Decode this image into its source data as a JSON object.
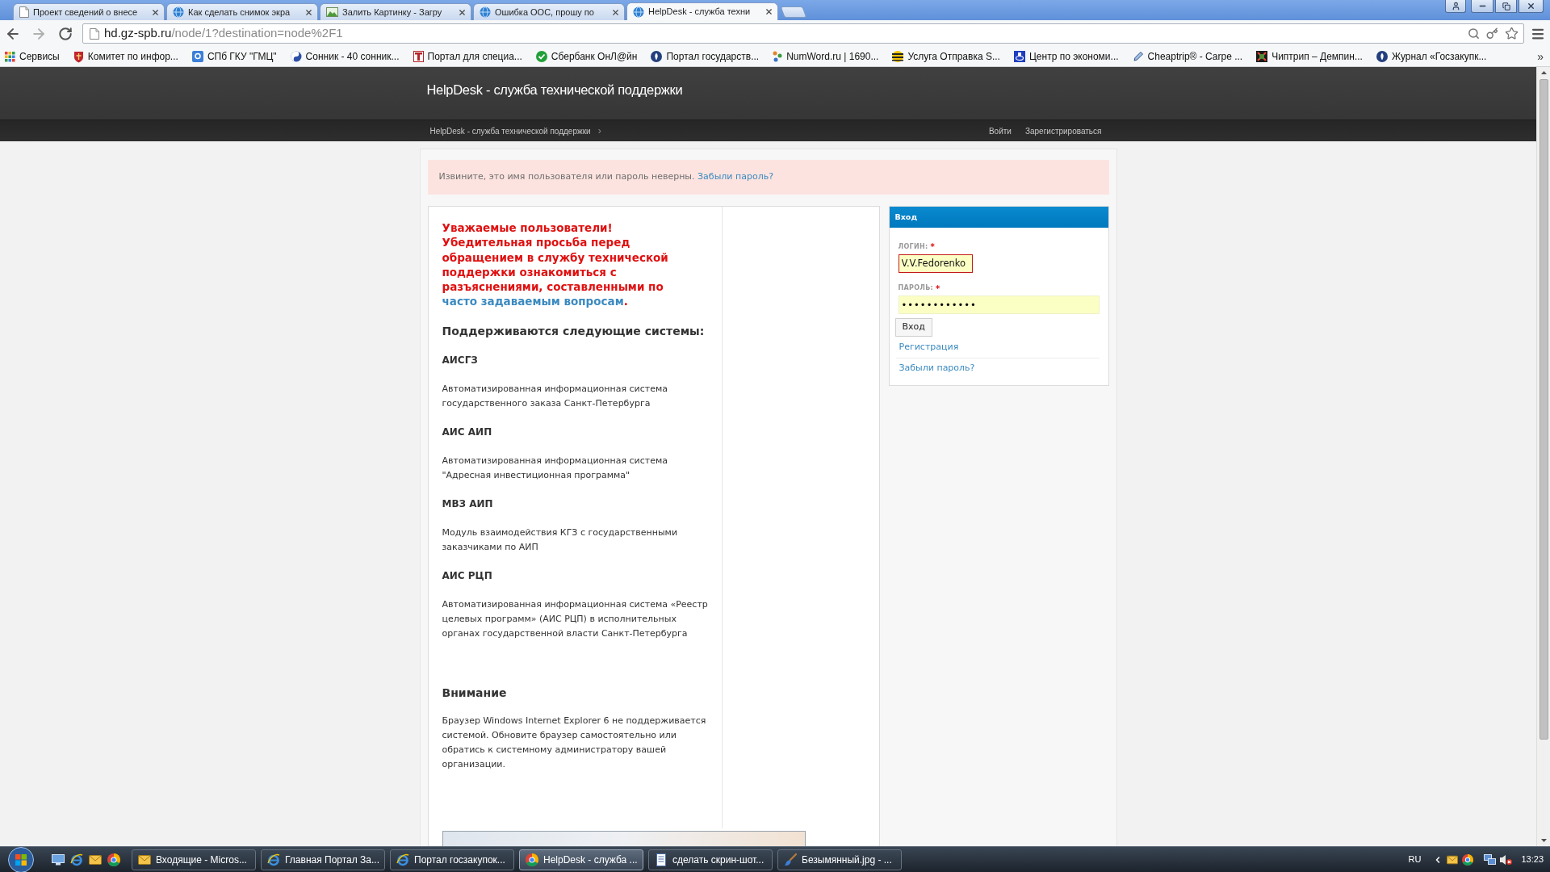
{
  "browser": {
    "tabs": [
      {
        "title": "Проект сведений о внесе",
        "selected": false
      },
      {
        "title": "Как сделать снимок экра",
        "selected": false
      },
      {
        "title": "Залить Картинку - Загру",
        "selected": false
      },
      {
        "title": "Ошибка ООС, прошу по",
        "selected": false
      },
      {
        "title": "HelpDesk - служба техни",
        "selected": true
      }
    ],
    "url": {
      "host": "hd.gz-spb.ru",
      "path": "/node/1?destination=node%2F1"
    },
    "bookmarks": [
      "Сервисы",
      "Комитет по инфор...",
      "СПб ГКУ \"ГМЦ\"",
      "Сонник - 40 сонник...",
      "Портал для специа...",
      "Сбербанк ОнЛ@йн",
      "Портал государств...",
      "NumWord.ru | 1690...",
      "Услуга Отправка S...",
      "Центр по экономи...",
      "Cheaptrip® - Carpe ...",
      "Чиптрип – Демпин...",
      "Журнал «Госзакупк..."
    ],
    "bookmarks_overflow": "»"
  },
  "site": {
    "title": "HelpDesk - служба технической поддержки",
    "breadcrumb": "HelpDesk - служба технической поддержки",
    "breadcrumb_separator": "›",
    "nav": [
      "Войти",
      "Зарегистрироваться"
    ]
  },
  "alert": {
    "text": "Извините, это имя пользователя или пароль неверны.",
    "link": "Забыли пароль?"
  },
  "notice": {
    "text": "Уважаемые пользователи! Убедительная просьба перед обращением в службу технической поддержки ознакомиться с разъяснениями, составленными по",
    "link": "часто задаваемым вопросам",
    "end": "."
  },
  "systems_heading": "Поддерживаются следующие системы:",
  "systems": [
    {
      "name": "АИСГЗ",
      "description": "Автоматизированная информационная система государственного заказа Санкт-Петербурга"
    },
    {
      "name": "АИС АИП",
      "description": "Автоматизированная информационная система \"Адресная инвестиционная программа\""
    },
    {
      "name": "МВЗ АИП",
      "description": "Модуль взаимодействия КГЗ с государственными заказчиками по АИП"
    },
    {
      "name": "АИС РЦП",
      "description": "Автоматизированная информационная система «Реестр целевых программ» (АИС РЦП) в исполнительных органах государственной власти Санкт-Петербурга"
    }
  ],
  "warning": {
    "heading": "Внимание",
    "text": "Браузер Windows Internet Explorer 6 не поддерживается системой. Обновите браузер самостоятельно или обратись к системному администратору вашей организации."
  },
  "login": {
    "title": "Вход",
    "fields": [
      {
        "kind": "text",
        "label": "ЛОГИН:",
        "required_mark": "*",
        "value": "V.V.Fedorenko",
        "error": true
      },
      {
        "kind": "password",
        "label": "ПАРОЛЬ:",
        "required_mark": "*",
        "value": "••••••••••••",
        "error": false
      }
    ],
    "submit": "Вход",
    "links": [
      "Регистрация",
      "Забыли пароль?"
    ]
  },
  "taskbar": {
    "tasks": [
      {
        "title": "Входящие - Micros...",
        "selected": false
      },
      {
        "title": "Главная Портал За...",
        "selected": false
      },
      {
        "title": "Портал госзакупок...",
        "selected": false
      },
      {
        "title": "HelpDesk - служба ...",
        "selected": true
      },
      {
        "title": "сделать скрин-шот...",
        "selected": false
      },
      {
        "title": "Безымянный.jpg - ...",
        "selected": false
      }
    ],
    "language": "RU",
    "time": "13:23"
  }
}
